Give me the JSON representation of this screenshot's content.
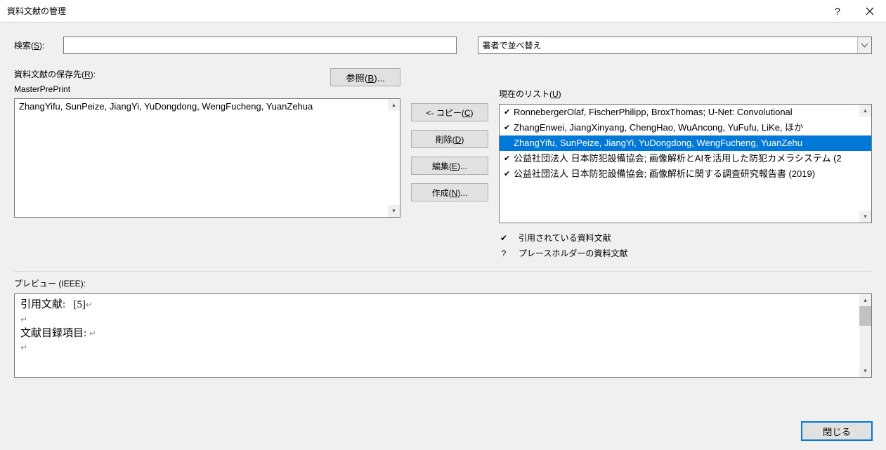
{
  "dialog": {
    "title": "資料文献の管理"
  },
  "search": {
    "label_prefix": "検索(",
    "label_key": "S",
    "label_suffix": "):"
  },
  "sort": {
    "value": "著者で並べ替え"
  },
  "store": {
    "label_prefix": "資料文献の保存先(",
    "label_key": "R",
    "label_suffix": "):",
    "master_name": "MasterPrePrint"
  },
  "browse": {
    "label_prefix": "参照(",
    "label_key": "B",
    "label_suffix": ")..."
  },
  "master_list": {
    "items": [
      "ZhangYifu, SunPeize, JiangYi, YuDongdong, WengFucheng, YuanZehua"
    ]
  },
  "current": {
    "label_prefix": "現在のリスト(",
    "label_key": "U",
    "label_suffix": ")"
  },
  "current_list": {
    "items": [
      {
        "cited": true,
        "text": "RonnebergerOlaf, FischerPhilipp, BroxThomas; U-Net: Convolutional",
        "selected": false
      },
      {
        "cited": true,
        "text": "ZhangEnwei, JiangXinyang, ChengHao, WuAncong, YuFufu, LiKe, ほか",
        "selected": false
      },
      {
        "cited": false,
        "text": "ZhangYifu, SunPeize, JiangYi, YuDongdong, WengFucheng, YuanZehu",
        "selected": true
      },
      {
        "cited": true,
        "text": "公益社団法人 日本防犯設備協会; 画像解析とAIを活用した防犯カメラシステム (2",
        "selected": false
      },
      {
        "cited": true,
        "text": "公益社団法人 日本防犯設備協会; 画像解析に関する調査研究報告書 (2019)",
        "selected": false
      }
    ]
  },
  "actions": {
    "copy_prefix": "<- コピー(",
    "copy_key": "C",
    "copy_suffix": ")",
    "delete_prefix": "削除(",
    "delete_key": "D",
    "delete_suffix": ")",
    "edit_prefix": "編集(",
    "edit_key": "E",
    "edit_suffix": ")...",
    "new_prefix": "作成(",
    "new_key": "N",
    "new_suffix": ")..."
  },
  "legend": {
    "cited": "引用されている資料文献",
    "placeholder": "プレースホルダーの資料文献"
  },
  "preview": {
    "label": "プレビュー (IEEE):",
    "citation_label": "引用文献:",
    "citation_value": "[5]",
    "biblio_label": "文献目録項目:"
  },
  "footer": {
    "close": "閉じる"
  }
}
